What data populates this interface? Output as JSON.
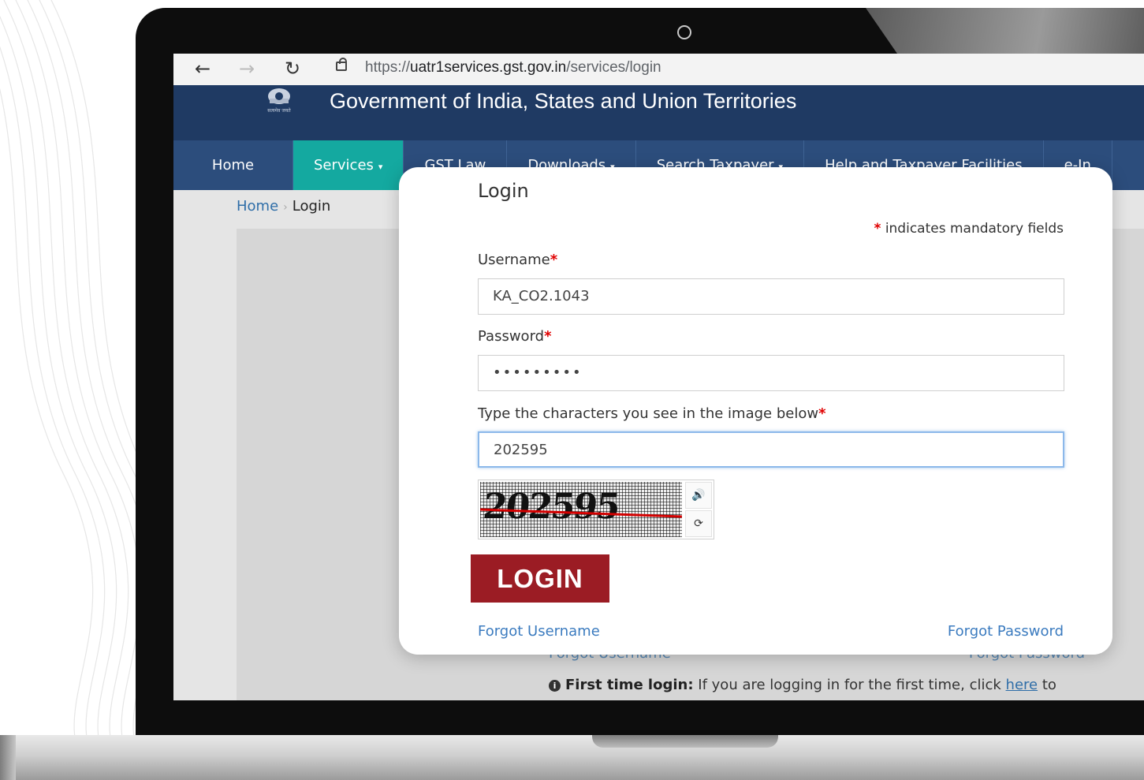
{
  "browser": {
    "url_scheme": "https://",
    "url_domain": "uatr1services.gst.gov.in",
    "url_path": "/services/login",
    "back_icon": "arrow-left-icon",
    "forward_icon": "arrow-right-icon",
    "reload_icon": "reload-icon"
  },
  "header": {
    "emblem_caption": "सत्यमेव जयते",
    "title": "Government of India, States and Union Territories"
  },
  "nav": {
    "items": [
      {
        "label": "Home",
        "caret": ""
      },
      {
        "label": "Services",
        "caret": "▾"
      },
      {
        "label": "GST Law",
        "caret": ""
      },
      {
        "label": "Downloads",
        "caret": "▾"
      },
      {
        "label": "Search Taxpayer",
        "caret": "▾"
      },
      {
        "label": "Help and Taxpayer Facilities",
        "caret": ""
      },
      {
        "label": "e-In",
        "caret": ""
      }
    ]
  },
  "breadcrumb": {
    "home": "Home",
    "current": "Login"
  },
  "login": {
    "title": "Login",
    "mandatory_note": "indicates mandatory fields",
    "required_mark": "*",
    "username_label": "Username",
    "username_value": "KA_CO2.1043",
    "password_label": "Password",
    "password_value": "•••••••••",
    "captcha_label": "Type the characters you see in the image below",
    "captcha_value": "202595",
    "captcha_image_text": "202595",
    "audio_icon": "speaker-icon",
    "refresh_icon": "refresh-icon",
    "login_button": "LOGIN",
    "forgot_username": "Forgot Username",
    "forgot_password": "Forgot Password"
  },
  "background_page": {
    "forgot_username": "Forgot Username",
    "forgot_password": "Forgot Password",
    "first_time_label": "First time login:",
    "first_time_text": "If you are logging in for the first time, click",
    "here_link": "here",
    "first_time_suffix": "to"
  },
  "colors": {
    "header_bg": "#1f3a63",
    "nav_bg": "#2c4d7c",
    "nav_active": "#14a9a0",
    "login_button": "#9b1c24",
    "link": "#3b7bbf"
  }
}
